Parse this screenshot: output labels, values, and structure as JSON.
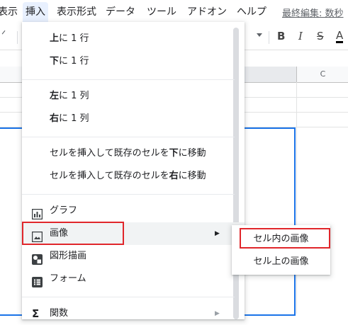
{
  "menubar": {
    "items": [
      "表示",
      "挿入",
      "表示形式",
      "データ",
      "ツール",
      "アドオン",
      "ヘルプ"
    ],
    "active": "挿入",
    "last_edit": "最終編集: 数秒"
  },
  "toolbar": {
    "bold": "B",
    "italic": "I",
    "strike": "S",
    "text_color": "A"
  },
  "sheet": {
    "column_c": "C"
  },
  "insert_menu": {
    "row_above": {
      "bold": "上",
      "rest": "に 1 行"
    },
    "row_below": {
      "bold": "下",
      "rest": "に 1 行"
    },
    "col_left": {
      "bold": "左",
      "rest": "に 1 列"
    },
    "col_right": {
      "bold": "右",
      "rest": "に 1 列"
    },
    "shift_down": {
      "pre": "セルを挿入して既存のセルを",
      "bold": "下",
      "post": "に移動"
    },
    "shift_right": {
      "pre": "セルを挿入して既存のセルを",
      "bold": "右",
      "post": "に移動"
    },
    "chart": "グラフ",
    "image": "画像",
    "drawing": "図形描画",
    "form": "フォーム",
    "function": "関数"
  },
  "image_submenu": {
    "in_cell": "セル内の画像",
    "over_cells": "セル上の画像"
  },
  "colors": {
    "highlight_red": "#e0262b",
    "selection_blue": "#1a73e8",
    "menu_hover": "#f1f3f4"
  }
}
